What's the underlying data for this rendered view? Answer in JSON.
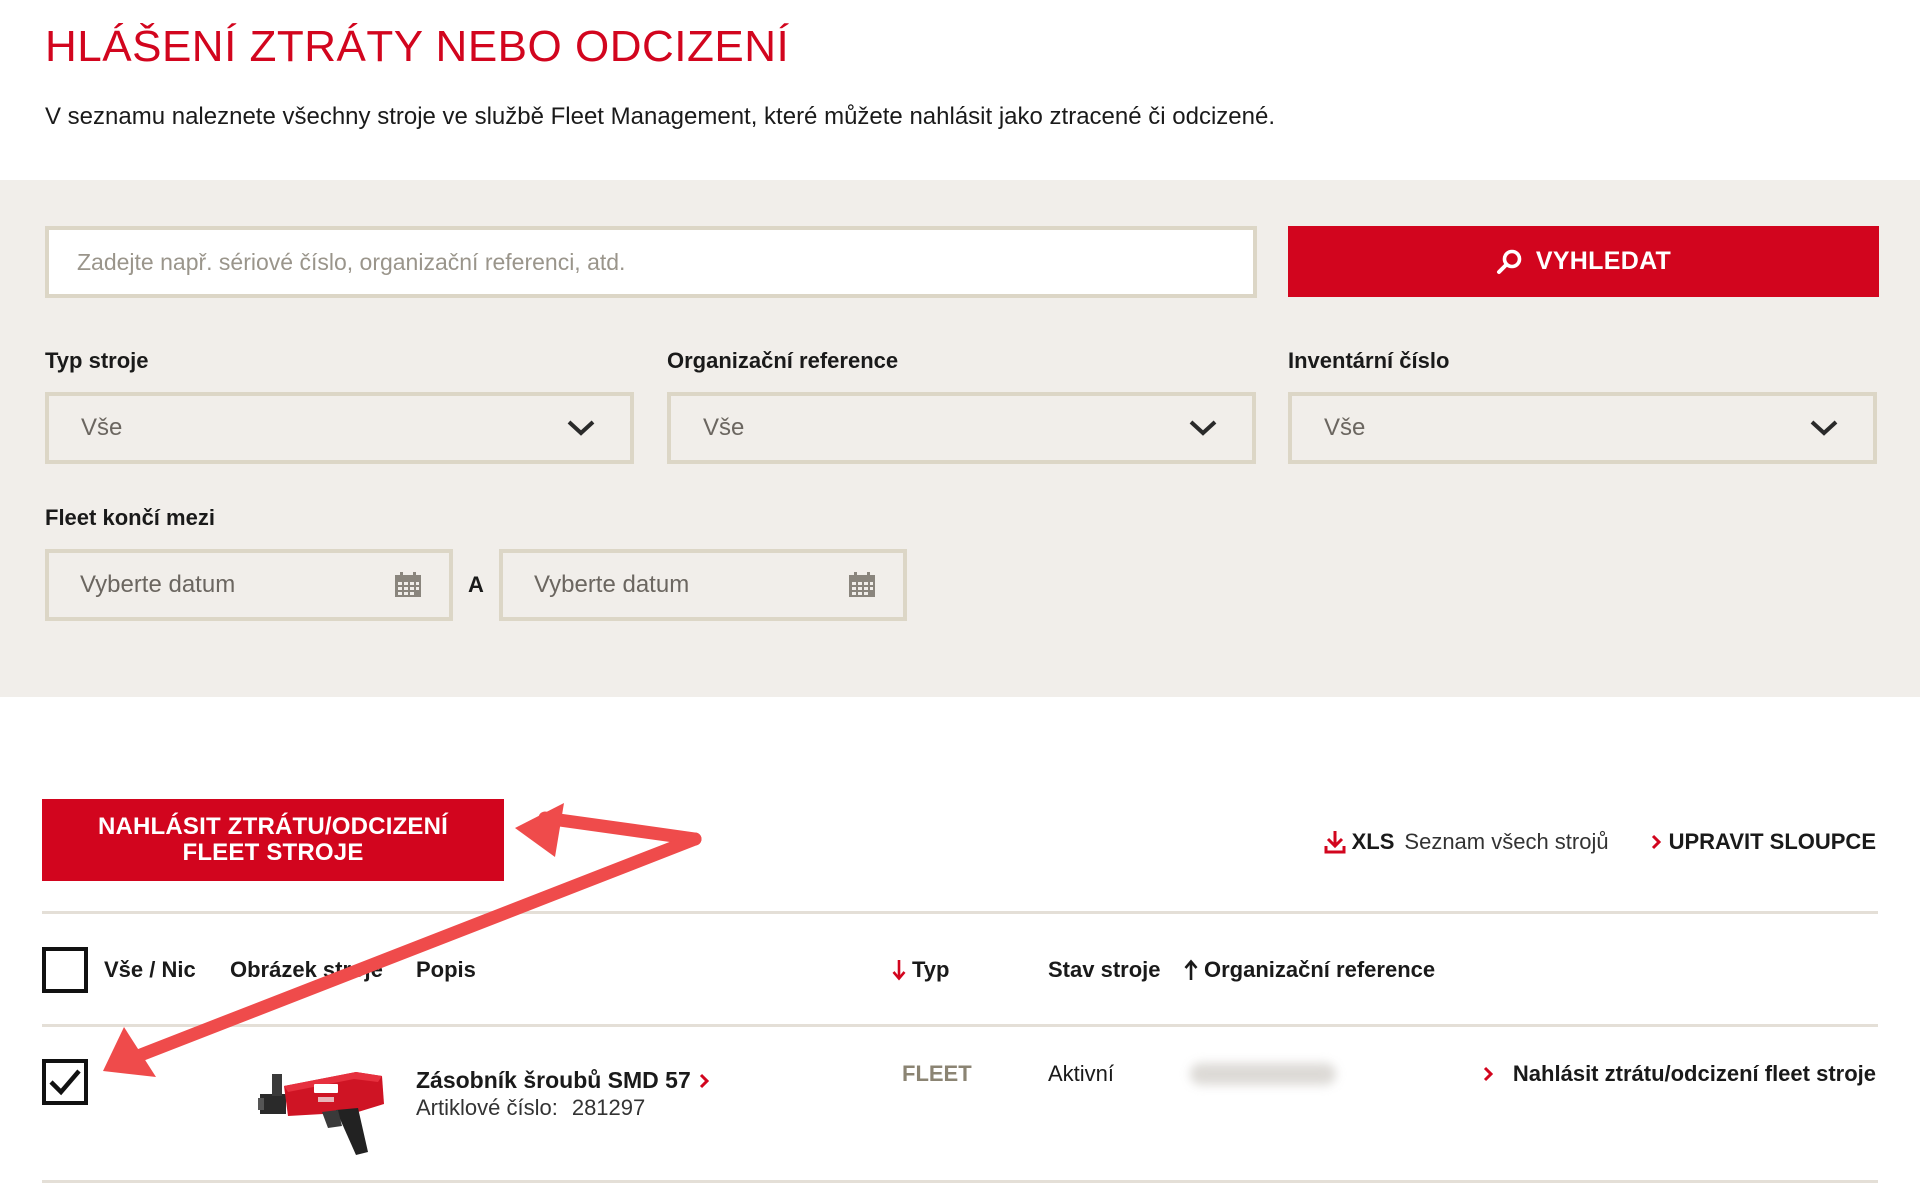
{
  "page": {
    "title": "HLÁŠENÍ ZTRÁTY NEBO ODCIZENÍ",
    "intro": "V seznamu naleznete všechny stroje ve službě Fleet Management, které můžete nahlásit jako ztracené či odcizené."
  },
  "search": {
    "placeholder": "Zadejte např. sériové číslo, organizační referenci, atd.",
    "value": "",
    "button_label": "VYHLEDAT",
    "button_icon": "search-icon"
  },
  "filters": {
    "machine_type": {
      "label": "Typ stroje",
      "value": "Vše"
    },
    "org_reference": {
      "label": "Organizační reference",
      "value": "Vše"
    },
    "inventory_number": {
      "label": "Inventární číslo",
      "value": "Vše"
    },
    "fleet_end": {
      "label": "Fleet končí mezi",
      "from_placeholder": "Vyberte datum",
      "separator": "A",
      "to_placeholder": "Vyberte datum"
    }
  },
  "toolbar": {
    "report_button_label": "NAHLÁSIT ZTRÁTU/ODCIZENÍ FLEET STROJE",
    "xls_label": "XLS",
    "xls_description": "Seznam všech strojů",
    "edit_columns_label": "UPRAVIT SLOUPCE"
  },
  "table": {
    "columns": {
      "select_all": "Vše / Nic",
      "image": "Obrázek stroje",
      "description": "Popis",
      "type": "Typ",
      "status": "Stav stroje",
      "org_reference": "Organizační reference"
    },
    "rows": [
      {
        "checked": true,
        "name": "Zásobník šroubů SMD 57",
        "article_label": "Artiklové číslo:",
        "article_number": "281297",
        "type": "FLEET",
        "status": "Aktivní",
        "action": "Nahlásit ztrátu/odcizení fleet stroje"
      }
    ]
  },
  "colors": {
    "brand_red": "#d2051e",
    "panel_bg": "#f1eeea",
    "border": "#dcd6c6",
    "annotation_arrow": "#ef4b4b"
  }
}
